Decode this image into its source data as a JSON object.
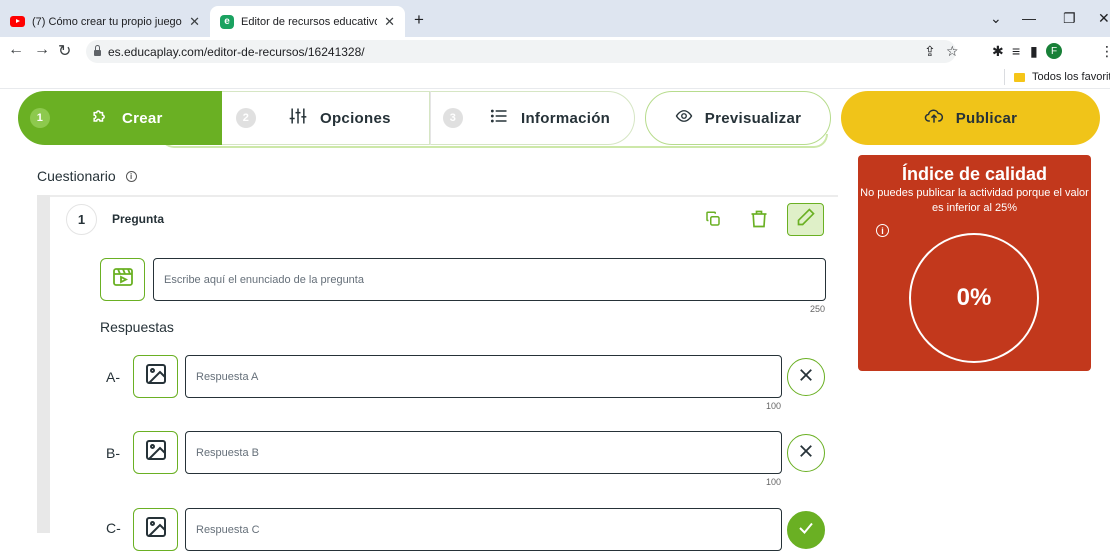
{
  "browser": {
    "tabs": [
      {
        "title": "(7) Cómo crear tu propio juego"
      },
      {
        "title": "Editor de recursos educativos:"
      }
    ],
    "url": "es.educaplay.com/editor-de-recursos/16241328/",
    "avatar_letter": "F",
    "bookmark_label": "Todos los favoritos"
  },
  "steps": [
    {
      "num": "1",
      "label": "Crear",
      "icon": "puzzle-icon"
    },
    {
      "num": "2",
      "label": "Opciones",
      "icon": "sliders-icon"
    },
    {
      "num": "3",
      "label": "Información",
      "icon": "list-icon"
    }
  ],
  "preview_label": "Previsualizar",
  "publish_label": "Publicar",
  "quiz": {
    "title": "Cuestionario",
    "info_glyph": "i",
    "question": {
      "number": "1",
      "label": "Pregunta",
      "placeholder": "Escribe aquí el enunciado de la pregunta",
      "max_chars": "250"
    },
    "answers_title": "Respuestas",
    "answers": [
      {
        "letter": "A-",
        "placeholder": "Respuesta A",
        "max_chars": "100",
        "correct": false
      },
      {
        "letter": "B-",
        "placeholder": "Respuesta B",
        "max_chars": "100",
        "correct": false
      },
      {
        "letter": "C-",
        "placeholder": "Respuesta C",
        "correct": true
      }
    ]
  },
  "quality": {
    "title": "Índice de calidad",
    "description": "No puedes publicar la actividad porque el valor es inferior al 25%",
    "info_glyph": "i",
    "value": "0%"
  },
  "colors": {
    "green": "#6ab023",
    "yellow": "#f0c419",
    "quality_red": "#c2381c"
  }
}
